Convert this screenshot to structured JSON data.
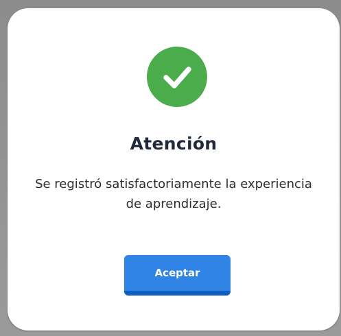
{
  "dialog": {
    "icon": "check-circle-icon",
    "title": "Atención",
    "message": "Se registró satisfactoriamente la experiencia de aprendizaje.",
    "accept_label": "Aceptar"
  },
  "colors": {
    "success_green": "#4aac4a",
    "button_blue": "#2f84e6",
    "button_shadow": "#0f5fc2",
    "title_text": "#20283a"
  }
}
